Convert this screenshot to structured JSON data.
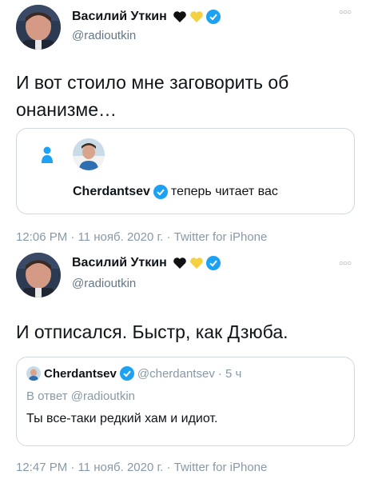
{
  "tweet1": {
    "author_name": "Василий Уткин",
    "author_handle": "@radioutkin",
    "text": "И вот стоило мне заговорить об онанизме…",
    "card": {
      "user_name": "Cherdantsev",
      "follow_text": "теперь читает вас"
    },
    "timestamp": "12:06 PM · 11 нояб. 2020 г. · Twitter for iPhone"
  },
  "tweet2": {
    "author_name": "Василий Уткин",
    "author_handle": "@radioutkin",
    "text": "И отписался. Быстр, как Дзюба.",
    "quote": {
      "user_name": "Cherdantsev",
      "user_handle": "@cherdantsev",
      "age": "· 5 ч",
      "reply_to": "В ответ @radioutkin",
      "text": "Ты все-таки редкий хам и идиот."
    },
    "timestamp": "12:47 PM · 11 нояб. 2020 г. · Twitter for iPhone"
  },
  "colors": {
    "verified": "#1da1f2",
    "heart_black": "#111111",
    "heart_yellow": "#f5d142",
    "secondary_text": "#8899a6",
    "border": "#cfd9de"
  },
  "icons": [
    "verified-icon",
    "black-heart-icon",
    "yellow-heart-icon",
    "more-icon",
    "person-icon"
  ]
}
